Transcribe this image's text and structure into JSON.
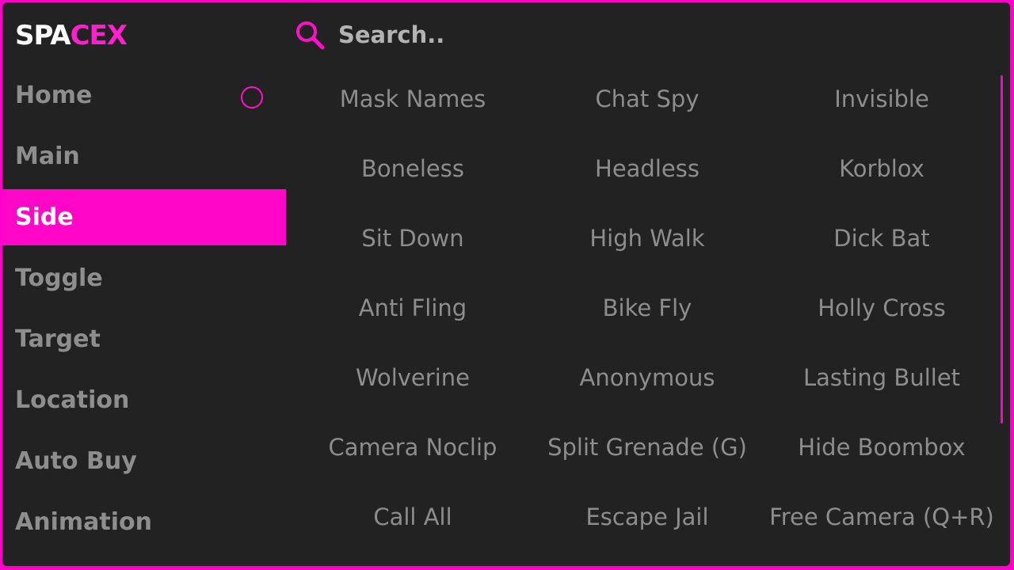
{
  "brand": {
    "part1": "SPA",
    "part2": "CEX"
  },
  "colors": {
    "accent": "#ff00c8",
    "background": "#222222",
    "text": "#8e8e8e"
  },
  "search": {
    "placeholder": "Search..",
    "icon": "search-icon"
  },
  "sidebar": {
    "items": [
      {
        "label": "Home"
      },
      {
        "label": "Main"
      },
      {
        "label": "Side",
        "active": true
      },
      {
        "label": "Toggle"
      },
      {
        "label": "Target"
      },
      {
        "label": "Location"
      },
      {
        "label": "Auto Buy"
      },
      {
        "label": "Animation"
      }
    ]
  },
  "options": [
    "Mask Names",
    "Chat Spy",
    "Invisible",
    "Boneless",
    "Headless",
    "Korblox",
    "Sit Down",
    "High Walk",
    "Dick Bat",
    "Anti Fling",
    "Bike Fly",
    "Holly Cross",
    "Wolverine",
    "Anonymous",
    "Lasting Bullet",
    "Camera Noclip",
    "Split Grenade (G)",
    "Hide Boombox",
    "Call All",
    "Escape Jail",
    "Free Camera (Q+R)"
  ]
}
